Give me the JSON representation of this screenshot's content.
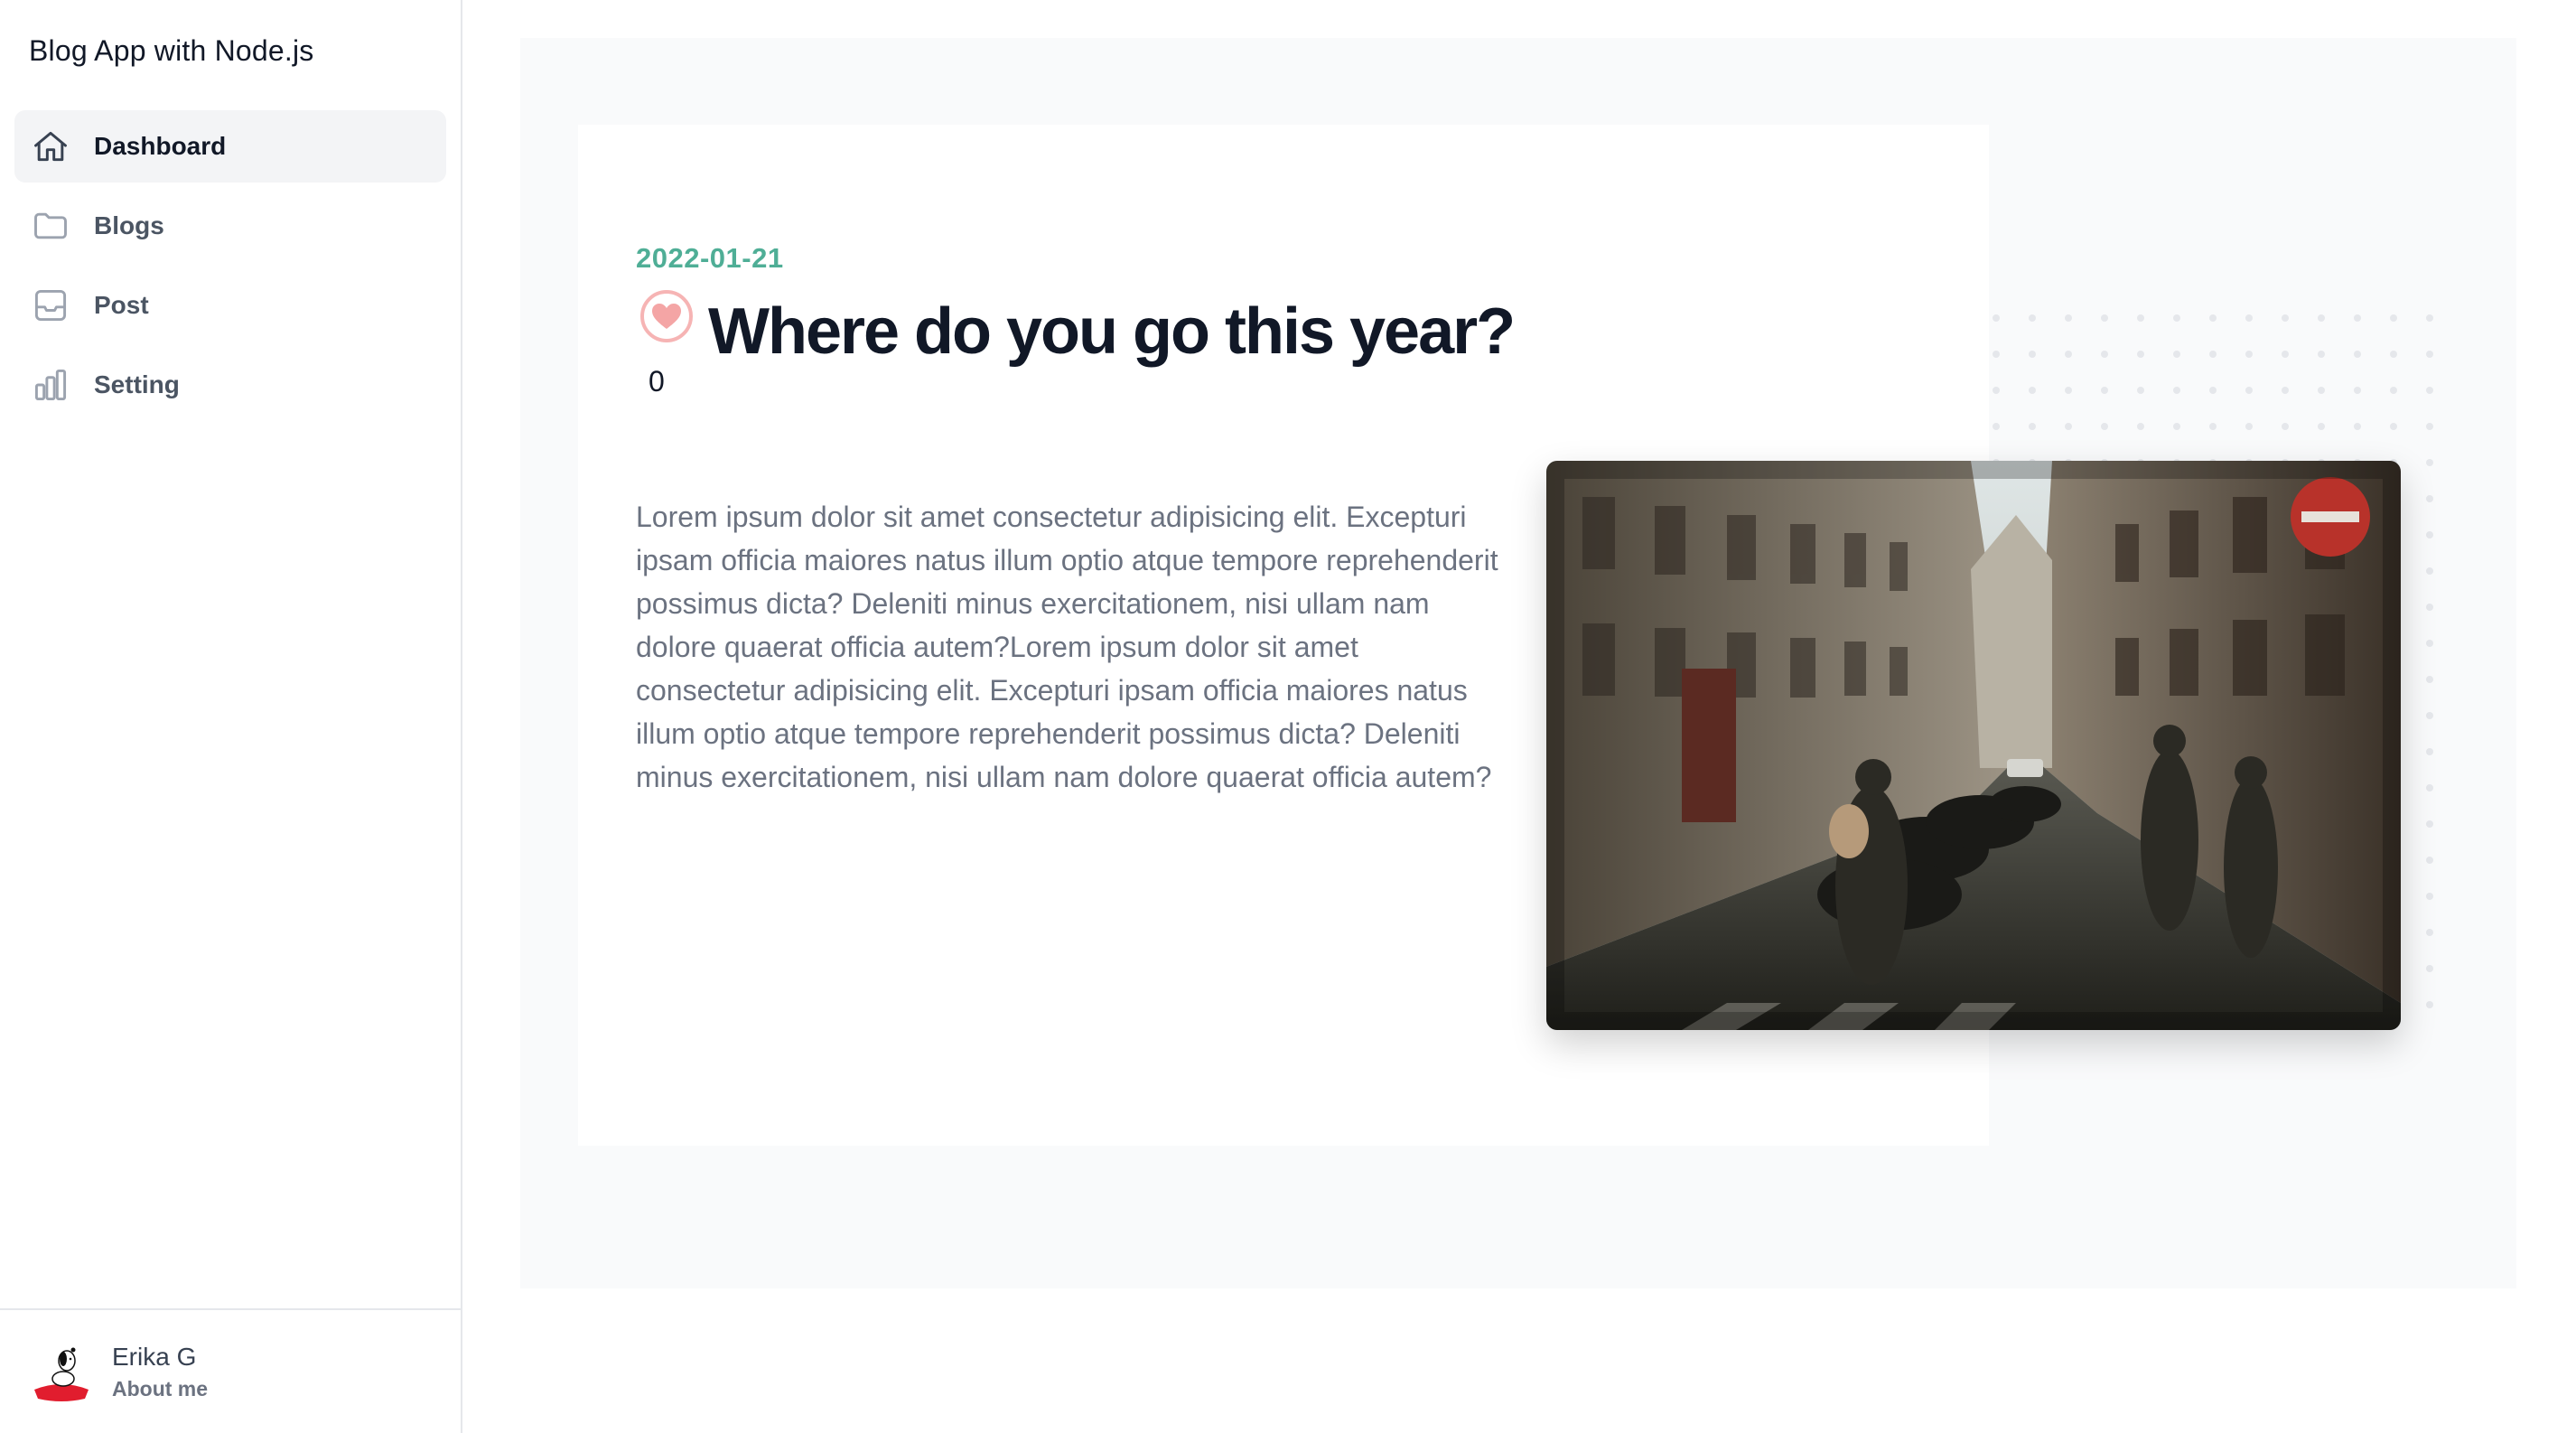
{
  "sidebar": {
    "app_title": "Blog App with Node.js",
    "items": [
      {
        "label": "Dashboard",
        "icon": "home-icon",
        "active": true
      },
      {
        "label": "Blogs",
        "icon": "folder-icon",
        "active": false
      },
      {
        "label": "Post",
        "icon": "inbox-icon",
        "active": false
      },
      {
        "label": "Setting",
        "icon": "bar-chart-icon",
        "active": false
      }
    ],
    "profile": {
      "name": "Erika G",
      "subtitle": "About me",
      "avatar": "snoopy-avatar"
    }
  },
  "post": {
    "date": "2022-01-21",
    "title": "Where do you go this year?",
    "likes": "0",
    "body": "Lorem ipsum dolor sit amet consectetur adipisicing elit. Excepturi ipsam officia maiores natus illum optio atque tempore reprehenderit possimus dicta? Deleniti minus exercitationem, nisi ullam nam dolore quaerat officia autem?Lorem ipsum dolor sit amet consectetur adipisicing elit. Excepturi ipsam officia maiores natus illum optio atque tempore reprehenderit possimus dicta? Deleniti minus exercitationem, nisi ullam nam dolore quaerat officia autem?",
    "image": "paris-street-photo"
  },
  "colors": {
    "accent": "#4fae96",
    "heart": "#f4a5a5",
    "title": "#111827",
    "body": "#6b7280",
    "active_nav_bg": "#f3f4f6",
    "panel_bg": "#f9fafb"
  }
}
